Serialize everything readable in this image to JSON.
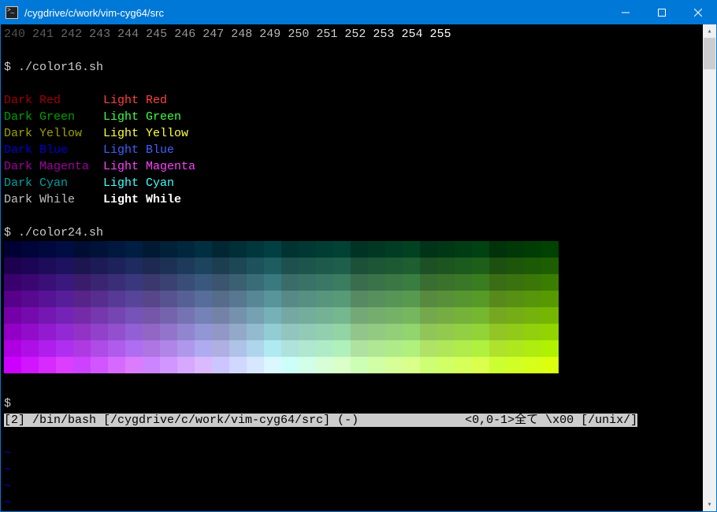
{
  "window": {
    "title": "/cygdrive/c/work/vim-cyg64/src"
  },
  "topRow": [
    "240",
    "241",
    "242",
    "243",
    "244",
    "245",
    "246",
    "247",
    "248",
    "249",
    "250",
    "251",
    "252",
    "253",
    "254",
    "255"
  ],
  "cmd1": {
    "prompt": "$ ",
    "command": "./color16.sh"
  },
  "colors16": {
    "dark": [
      {
        "label": "Dark Red",
        "color": "#a00000"
      },
      {
        "label": "Dark Green",
        "color": "#00a000"
      },
      {
        "label": "Dark Yellow",
        "color": "#a0a000"
      },
      {
        "label": "Dark Blue",
        "color": "#0000d0"
      },
      {
        "label": "Dark Magenta",
        "color": "#a000a0"
      },
      {
        "label": "Dark Cyan",
        "color": "#00a0a0"
      },
      {
        "label": "Dark While",
        "color": "#c0c0c0"
      }
    ],
    "light": [
      {
        "label": "Light Red",
        "color": "#ff4040"
      },
      {
        "label": "Light Green",
        "color": "#40ff40"
      },
      {
        "label": "Light Yellow",
        "color": "#ffff40"
      },
      {
        "label": "Light Blue",
        "color": "#4060ff"
      },
      {
        "label": "Light Magenta",
        "color": "#ff40ff"
      },
      {
        "label": "Light Cyan",
        "color": "#40ffff"
      },
      {
        "label": "Light While",
        "color": "#ffffff",
        "bold": true
      }
    ]
  },
  "cmd2": {
    "prompt": "$ ",
    "command": "./color24.sh"
  },
  "prompt3": "$",
  "status": {
    "buf": "[2]",
    "shell": " /bin/bash ",
    "path": "[/cygdrive/c/work/vim-cyg64/src]",
    "mode": " (-)",
    "gap": "     ",
    "pos": "<0,0-1>全て",
    "enc": " \\x00 ",
    "ff": "[/unix/]"
  },
  "tildes": "~\n~\n~\n~",
  "gradientCols": 32,
  "gradientRows": 8
}
